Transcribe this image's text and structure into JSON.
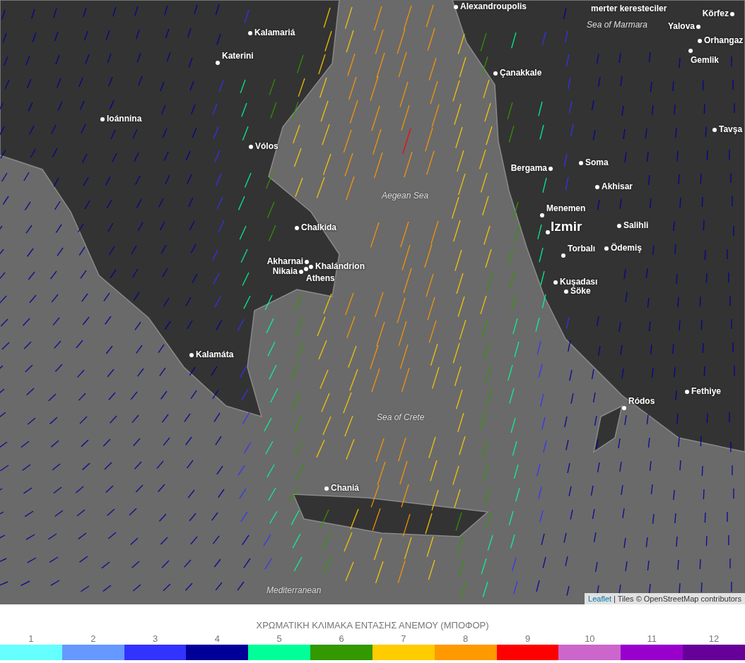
{
  "map": {
    "cities": [
      {
        "name": "Alexandroupolis"
      },
      {
        "name": "merter keresteciler"
      },
      {
        "name": "Körfez"
      },
      {
        "name": "Yalova"
      },
      {
        "name": "Orhangaz"
      },
      {
        "name": "Gemlik"
      },
      {
        "name": "Kalamariá"
      },
      {
        "name": "Katerini"
      },
      {
        "name": "Çanakkale"
      },
      {
        "name": "Ioánnina"
      },
      {
        "name": "Vólos"
      },
      {
        "name": "Bergama"
      },
      {
        "name": "Soma"
      },
      {
        "name": "Akhisar"
      },
      {
        "name": "Menemen"
      },
      {
        "name": "Izmir"
      },
      {
        "name": "Torbalı"
      },
      {
        "name": "Salihli"
      },
      {
        "name": "Ödemiş"
      },
      {
        "name": "Kuşadası"
      },
      {
        "name": "Söke"
      },
      {
        "name": "Tavşa"
      },
      {
        "name": "Chalkida"
      },
      {
        "name": "Akharnai"
      },
      {
        "name": "Khalándrion"
      },
      {
        "name": "Nikaia"
      },
      {
        "name": "Athens"
      },
      {
        "name": "Kalamáta"
      },
      {
        "name": "Fethiye"
      },
      {
        "name": "Ródos"
      },
      {
        "name": "Chaniá"
      }
    ],
    "seas": [
      {
        "name": "Sea of Marmara"
      },
      {
        "name": "Aegean Sea"
      },
      {
        "name": "Sea of Crete"
      },
      {
        "name": "Mediterranean"
      }
    ],
    "attribution": {
      "link": "Leaflet",
      "text": "| Tiles © OpenStreetMap contributors"
    }
  },
  "legend": {
    "title": "ΧΡΩΜΑΤΙΚΗ ΚΛΙΜΑΚΑ ΕΝΤΑΣΗΣ ΑΝΕΜΟΥ (ΜΠΟΦΟΡ)",
    "levels": [
      {
        "label": "1",
        "color": "#66ffff"
      },
      {
        "label": "2",
        "color": "#6699ff"
      },
      {
        "label": "3",
        "color": "#3333ff"
      },
      {
        "label": "4",
        "color": "#000099"
      },
      {
        "label": "5",
        "color": "#00ff99"
      },
      {
        "label": "6",
        "color": "#339900"
      },
      {
        "label": "7",
        "color": "#ffcc00"
      },
      {
        "label": "8",
        "color": "#ff9900"
      },
      {
        "label": "9",
        "color": "#ff0000"
      },
      {
        "label": "10",
        "color": "#cc66cc"
      },
      {
        "label": "11",
        "color": "#9900cc"
      },
      {
        "label": "12",
        "color": "#660099"
      }
    ]
  }
}
